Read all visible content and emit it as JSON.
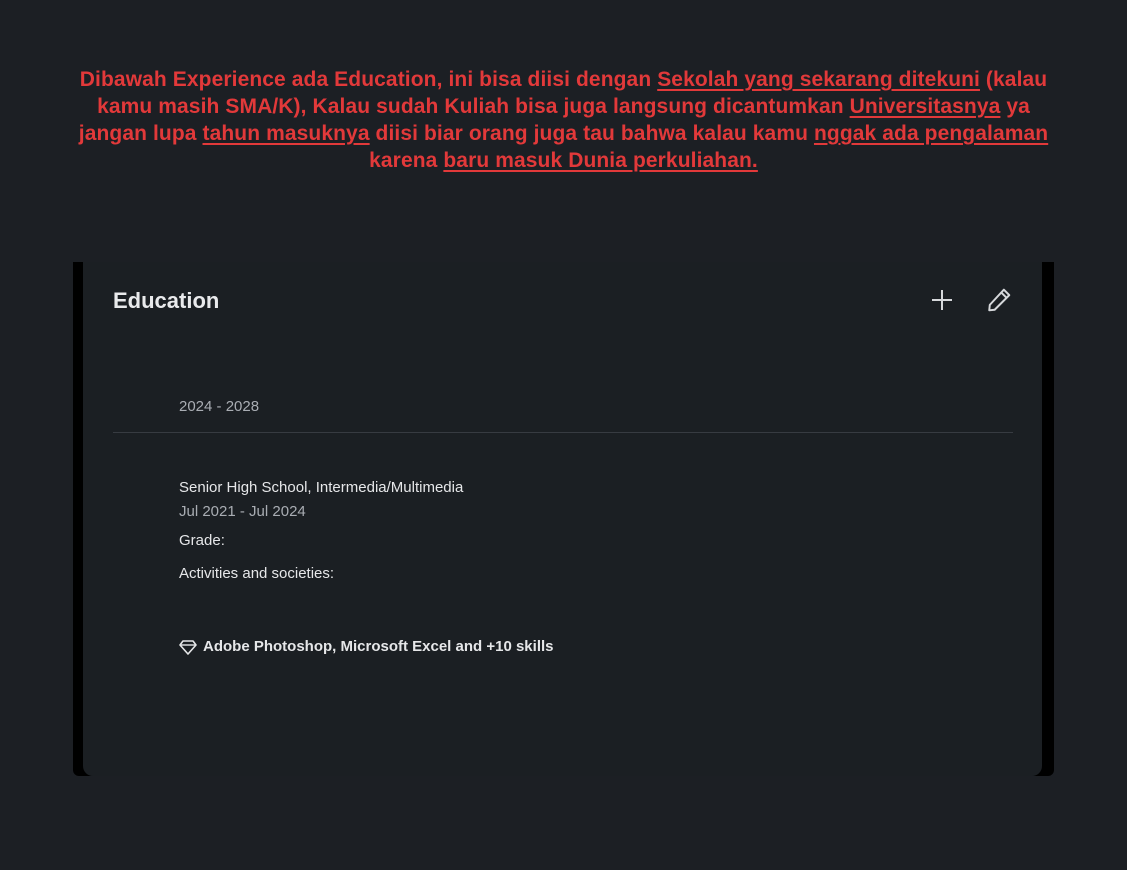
{
  "annotation": {
    "part1": "Dibawah Experience ada Education, ini bisa diisi dengan ",
    "u1": "Sekolah yang sekarang ditekuni",
    "part2": " (kalau kamu masih SMA/K), Kalau sudah Kuliah bisa juga langsung dicantumkan ",
    "u2": "Universitasnya",
    "part3": " ya jangan lupa ",
    "u3": "tahun masuknya",
    "part4": " diisi biar orang juga tau bahwa kalau kamu ",
    "u4": "nggak ada pengalaman",
    "part5": " karena ",
    "u5": "baru masuk Dunia perkuliahan.",
    "color": "#e2393a"
  },
  "section": {
    "title": "Education",
    "add_icon": "plus-icon",
    "edit_icon": "pencil-icon"
  },
  "entries": [
    {
      "dates": "2024 - 2028"
    },
    {
      "title": "Senior High School, Intermedia/Multimedia",
      "dates": "Jul 2021 - Jul 2024",
      "grade_label": "Grade:",
      "activities_label": "Activities and societies:"
    }
  ],
  "skills": {
    "icon": "diamond-icon",
    "text": "Adobe Photoshop, Microsoft Excel and +10 skills"
  }
}
